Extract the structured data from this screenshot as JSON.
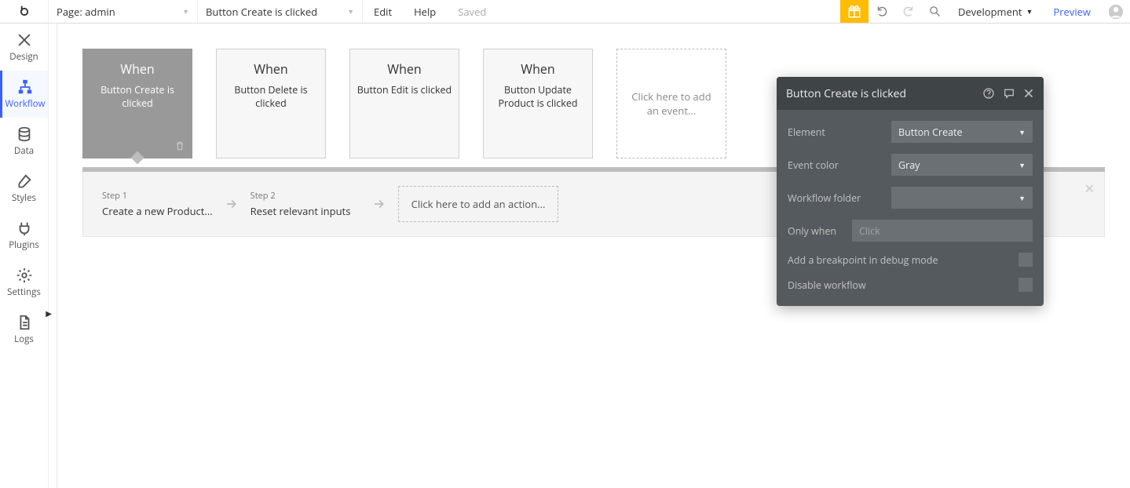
{
  "topbar": {
    "page_label": "Page: admin",
    "workflow_selector": "Button Create is clicked",
    "edit": "Edit",
    "help": "Help",
    "saved": "Saved",
    "dev": "Development",
    "preview": "Preview"
  },
  "sidebar": {
    "tabs": [
      "Design",
      "Workflow",
      "Data",
      "Styles",
      "Plugins",
      "Settings",
      "Logs"
    ],
    "active_index": 1
  },
  "events": [
    {
      "when": "When",
      "desc": "Button Create is clicked",
      "active": true
    },
    {
      "when": "When",
      "desc": "Button Delete is clicked"
    },
    {
      "when": "When",
      "desc": "Button Edit is clicked"
    },
    {
      "when": "When",
      "desc": "Button Update Product is clicked"
    }
  ],
  "add_event_text": "Click here to add an event...",
  "steps": [
    {
      "label": "Step 1",
      "title": "Create a new Product..."
    },
    {
      "label": "Step 2",
      "title": "Reset relevant inputs"
    }
  ],
  "add_action_text": "Click here to add an action...",
  "panel": {
    "title": "Button Create is clicked",
    "rows": {
      "element_label": "Element",
      "element_value": "Button Create",
      "color_label": "Event color",
      "color_value": "Gray",
      "folder_label": "Workflow folder",
      "folder_value": "",
      "only_when_label": "Only when",
      "only_when_placeholder": "Click",
      "breakpoint_label": "Add a breakpoint in debug mode",
      "disable_label": "Disable workflow"
    }
  }
}
